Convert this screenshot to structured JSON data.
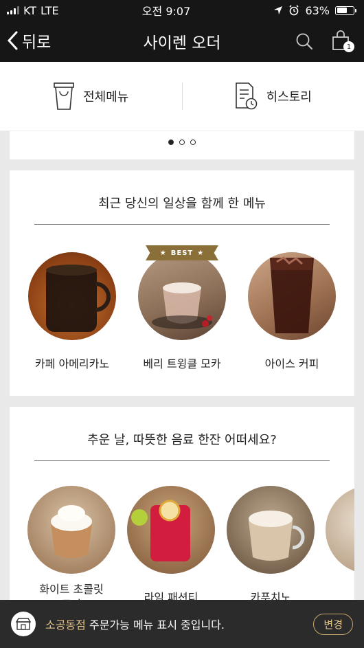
{
  "status_bar": {
    "carrier": "KT",
    "network": "LTE",
    "time": "오전 9:07",
    "battery": "63%",
    "battery_level": 0.63
  },
  "header": {
    "back_label": "뒤로",
    "title": "사이렌 오더",
    "cart_count": "1"
  },
  "menu_tabs": [
    {
      "label": "전체메뉴",
      "icon": "cup-icon"
    },
    {
      "label": "히스토리",
      "icon": "history-icon"
    }
  ],
  "carousel": {
    "pages": 3,
    "active": 1
  },
  "sections": [
    {
      "title": "최근 당신의 일상을 함께 한 메뉴",
      "items": [
        {
          "name": "카페 아메리카노"
        },
        {
          "name": "베리 트윙클 모카",
          "badge": "BEST"
        },
        {
          "name": "아이스 커피"
        }
      ]
    },
    {
      "title": "추운 날, 따뜻한 음료 한잔 어떠세요?",
      "items": [
        {
          "name": "화이트 초콜릿 모카"
        },
        {
          "name": "라임 패션티"
        },
        {
          "name": "카푸치노"
        }
      ]
    }
  ],
  "bottom_bar": {
    "store_name": "소공동점",
    "message": " 주문가능 메뉴 표시 중입니다.",
    "change_label": "변경"
  },
  "colors": {
    "header_bg": "#161616",
    "accent_gold": "#c8a86b",
    "bottom_bg": "#2b2b2b"
  }
}
